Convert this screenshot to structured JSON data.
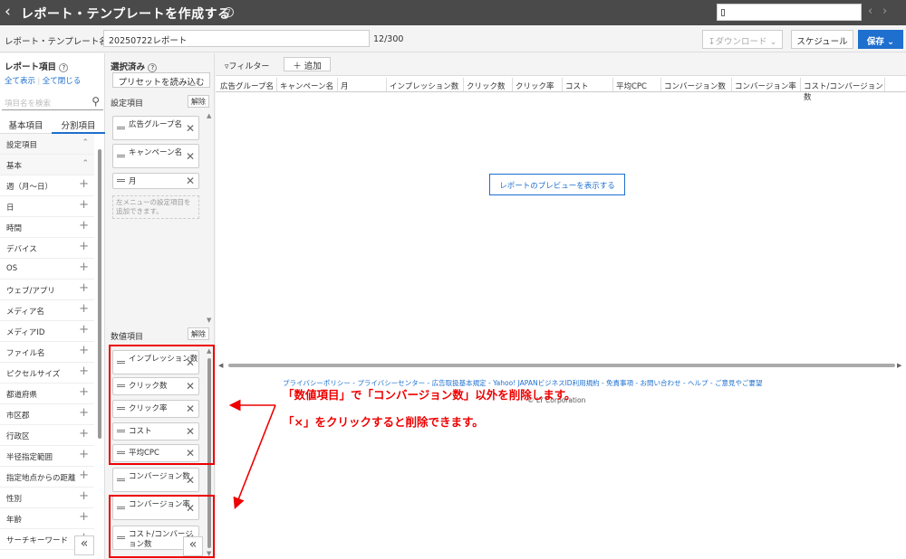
{
  "header": {
    "title": "レポート・テンプレートを作成する",
    "help_icon": "?"
  },
  "namebar": {
    "label": "レポート・テンプレート名",
    "value": "20250722レポート",
    "count": "12/300",
    "download_label": "ダウンロード",
    "schedule_label": "スケジュール",
    "save_label": "保存"
  },
  "left": {
    "title": "レポート項目",
    "show_all": "全て表示",
    "close_all": "全て閉じる",
    "search_placeholder": "項目名を検索",
    "tab_basic": "基本項目",
    "tab_segment": "分割項目",
    "items": [
      {
        "label": "設定項目",
        "group": true
      },
      {
        "label": "基本",
        "group": true
      },
      {
        "label": "週（月〜日）"
      },
      {
        "label": "日"
      },
      {
        "label": "時間"
      },
      {
        "label": "デバイス"
      },
      {
        "label": "OS"
      },
      {
        "label": "ウェブ/アプリ"
      },
      {
        "label": "メディア名"
      },
      {
        "label": "メディアID"
      },
      {
        "label": "ファイル名"
      },
      {
        "label": "ピクセルサイズ"
      },
      {
        "label": "都道府県"
      },
      {
        "label": "市区郡"
      },
      {
        "label": "行政区"
      },
      {
        "label": "半径指定範囲"
      },
      {
        "label": "指定地点からの距離"
      },
      {
        "label": "性別"
      },
      {
        "label": "年齢"
      },
      {
        "label": "サーチキーワード"
      }
    ]
  },
  "middle": {
    "title": "選択済み",
    "preset_button": "プリセットを読み込む",
    "setting_title": "設定項目",
    "setting_clear": "解除",
    "setting_items": [
      "広告グループ名",
      "キャンペーン名",
      "月"
    ],
    "setting_hint": "左メニューの設定項目を追加できます。",
    "numeric_title": "数値項目",
    "numeric_clear": "解除",
    "numeric_items": [
      "インプレッション数",
      "クリック数",
      "クリック率",
      "コスト",
      "平均CPC",
      "コンバージョン数",
      "コンバージョン率",
      "コスト/コンバージョン数"
    ]
  },
  "right": {
    "filter_label": "フィルター",
    "add_label": "追加",
    "columns": [
      "広告グループ名",
      "キャンペーン名",
      "月",
      "インプレッション数",
      "クリック数",
      "クリック率",
      "コスト",
      "平均CPC",
      "コンバージョン数",
      "コンバージョン率",
      "コスト/コンバージョン数"
    ],
    "preview_button": "レポートのプレビューを表示する"
  },
  "footer": {
    "links": "プライバシーポリシー - プライバシーセンター - 広告取扱基本規定 - Yahoo! JAPANビジネスID利用規約 - 免責事項 - お問い合わせ - ヘルプ - ご意見やご要望",
    "copyright": "© LY Corporation"
  },
  "annotation": {
    "line1": "「数値項目」で「コンバージョン数」以外を削除します。",
    "line2": "「×」をクリックすると削除できます。"
  },
  "colors": {
    "accent": "#1e6fce",
    "annotation": "#e00000",
    "header": "#4a4a4a"
  }
}
